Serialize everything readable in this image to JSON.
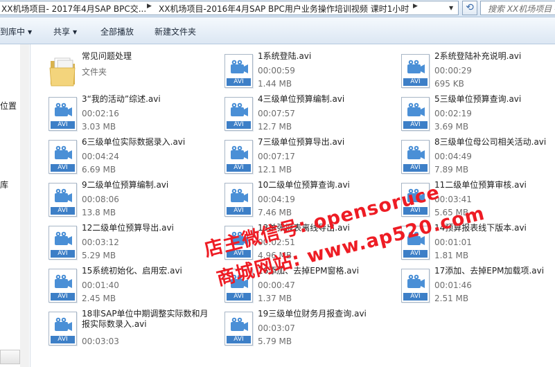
{
  "address": {
    "crumb1": "XX机场项目- 2017年4月SAP BPC交...",
    "crumb2": "XX机场项目-2016年4月SAP BPC用户业务操作培训视频 课时1小时",
    "search_placeholder": "搜索 XX机场项目 -"
  },
  "toolbar": {
    "include_label": "到库中",
    "share_label": "共享",
    "playall_label": "全部播放",
    "newfolder_label": "新建文件夹"
  },
  "nav": {
    "item1": "位置",
    "item2": "库"
  },
  "folder": {
    "name": "常见问题处理",
    "type": "文件夹"
  },
  "files": [
    {
      "name": "1系统登陆.avi",
      "duration": "00:00:59",
      "size": "1.44 MB"
    },
    {
      "name": "2系统登陆补充说明.avi",
      "duration": "00:00:29",
      "size": "695 KB"
    },
    {
      "name": "3“我的活动”综述.avi",
      "duration": "00:02:16",
      "size": "3.03 MB"
    },
    {
      "name": "4三级单位预算编制.avi",
      "duration": "00:07:57",
      "size": "12.7 MB"
    },
    {
      "name": "5三级单位预算查询.avi",
      "duration": "00:02:19",
      "size": "3.69 MB"
    },
    {
      "name": "6三级单位实际数据录入.avi",
      "duration": "00:04:24",
      "size": "6.69 MB"
    },
    {
      "name": "7三级单位预算导出.avi",
      "duration": "00:07:17",
      "size": "12.1 MB"
    },
    {
      "name": "8三级单位母公司相关活动.avi",
      "duration": "00:04:49",
      "size": "7.89 MB"
    },
    {
      "name": "9二级单位预算编制.avi",
      "duration": "00:08:06",
      "size": "13.8 MB"
    },
    {
      "name": "10二级单位预算查询.avi",
      "duration": "00:04:19",
      "size": "7.46 MB"
    },
    {
      "name": "11二级单位预算审核.avi",
      "duration": "00:03:41",
      "size": "5.65 MB"
    },
    {
      "name": "12二级单位预算导出.avi",
      "duration": "00:03:12",
      "size": "5.29 MB"
    },
    {
      "name": "13单张报表离线导出.avi",
      "duration": "00:02:51",
      "size": "4.96 MB"
    },
    {
      "name": "14预算报表线下版本.avi",
      "duration": "00:01:01",
      "size": "1.81 MB"
    },
    {
      "name": "15系统初始化、启用宏.avi",
      "duration": "00:01:40",
      "size": "2.45 MB"
    },
    {
      "name": "16添加、去掉EPM窗格.avi",
      "duration": "00:00:47",
      "size": "1.37 MB"
    },
    {
      "name": "17添加、去掉EPM加载项.avi",
      "duration": "00:01:46",
      "size": "2.51 MB"
    },
    {
      "name": "18非SAP单位中期调整实际数和月报实际数录入.avi",
      "duration": "00:03:03",
      "size": ""
    },
    {
      "name": "19三级单位财务月报查询.avi",
      "duration": "00:03:07",
      "size": "5.79 MB"
    }
  ],
  "icon_label": "AVI",
  "watermark": {
    "line1": "店主微信号: opensoruce",
    "line2": "商城网站: www.ap520.com"
  },
  "colors": {
    "accent": "#3d7fc7",
    "watermark": "#ee1c24"
  }
}
